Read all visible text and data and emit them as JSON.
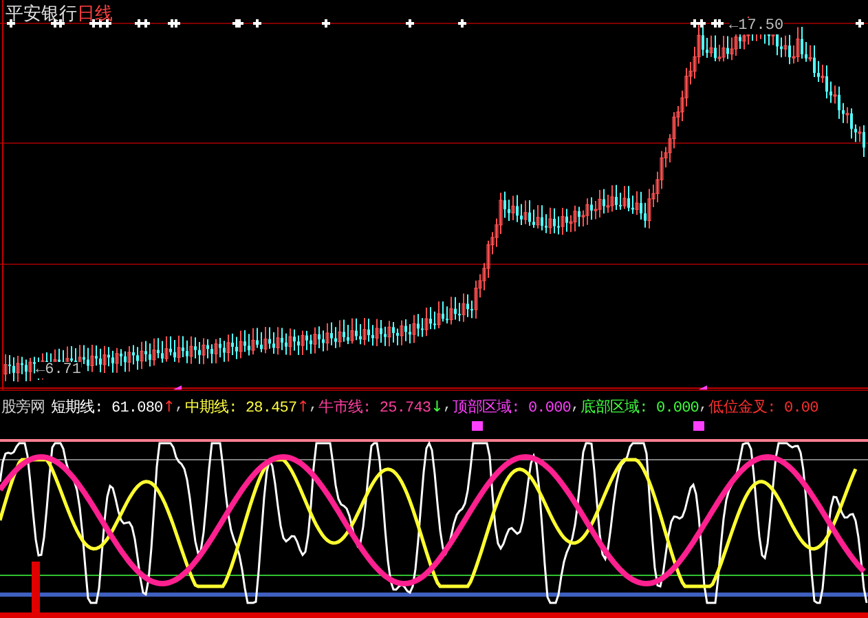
{
  "stock": {
    "name": "平安银行",
    "period": "日线"
  },
  "price_labels": [
    {
      "kind": "high",
      "text": "←17.50"
    },
    {
      "kind": "low",
      "text": "←6.71"
    }
  ],
  "indicator": {
    "name": "股旁网",
    "items": [
      {
        "text": "短期线: 61.080",
        "color": "#ffffff",
        "arrow": {
          "text": "↑",
          "color": "#ff3030"
        },
        "separator": ","
      },
      {
        "text": "中期线: 28.457",
        "color": "#ffff40",
        "arrow": {
          "text": "↑",
          "color": "#ff3030"
        },
        "separator": ","
      },
      {
        "text": "牛市线: 25.743",
        "color": "#ff40a0",
        "arrow": {
          "text": "↓",
          "color": "#40ff40"
        },
        "separator": ","
      },
      {
        "text": "顶部区域: 0.000",
        "color": "#ff40ff",
        "separator": ","
      },
      {
        "text": "底部区域: 0.000",
        "color": "#40ff40",
        "separator": ","
      },
      {
        "text": "低位金叉: 0.00",
        "color": "#ff3030"
      }
    ]
  }
}
